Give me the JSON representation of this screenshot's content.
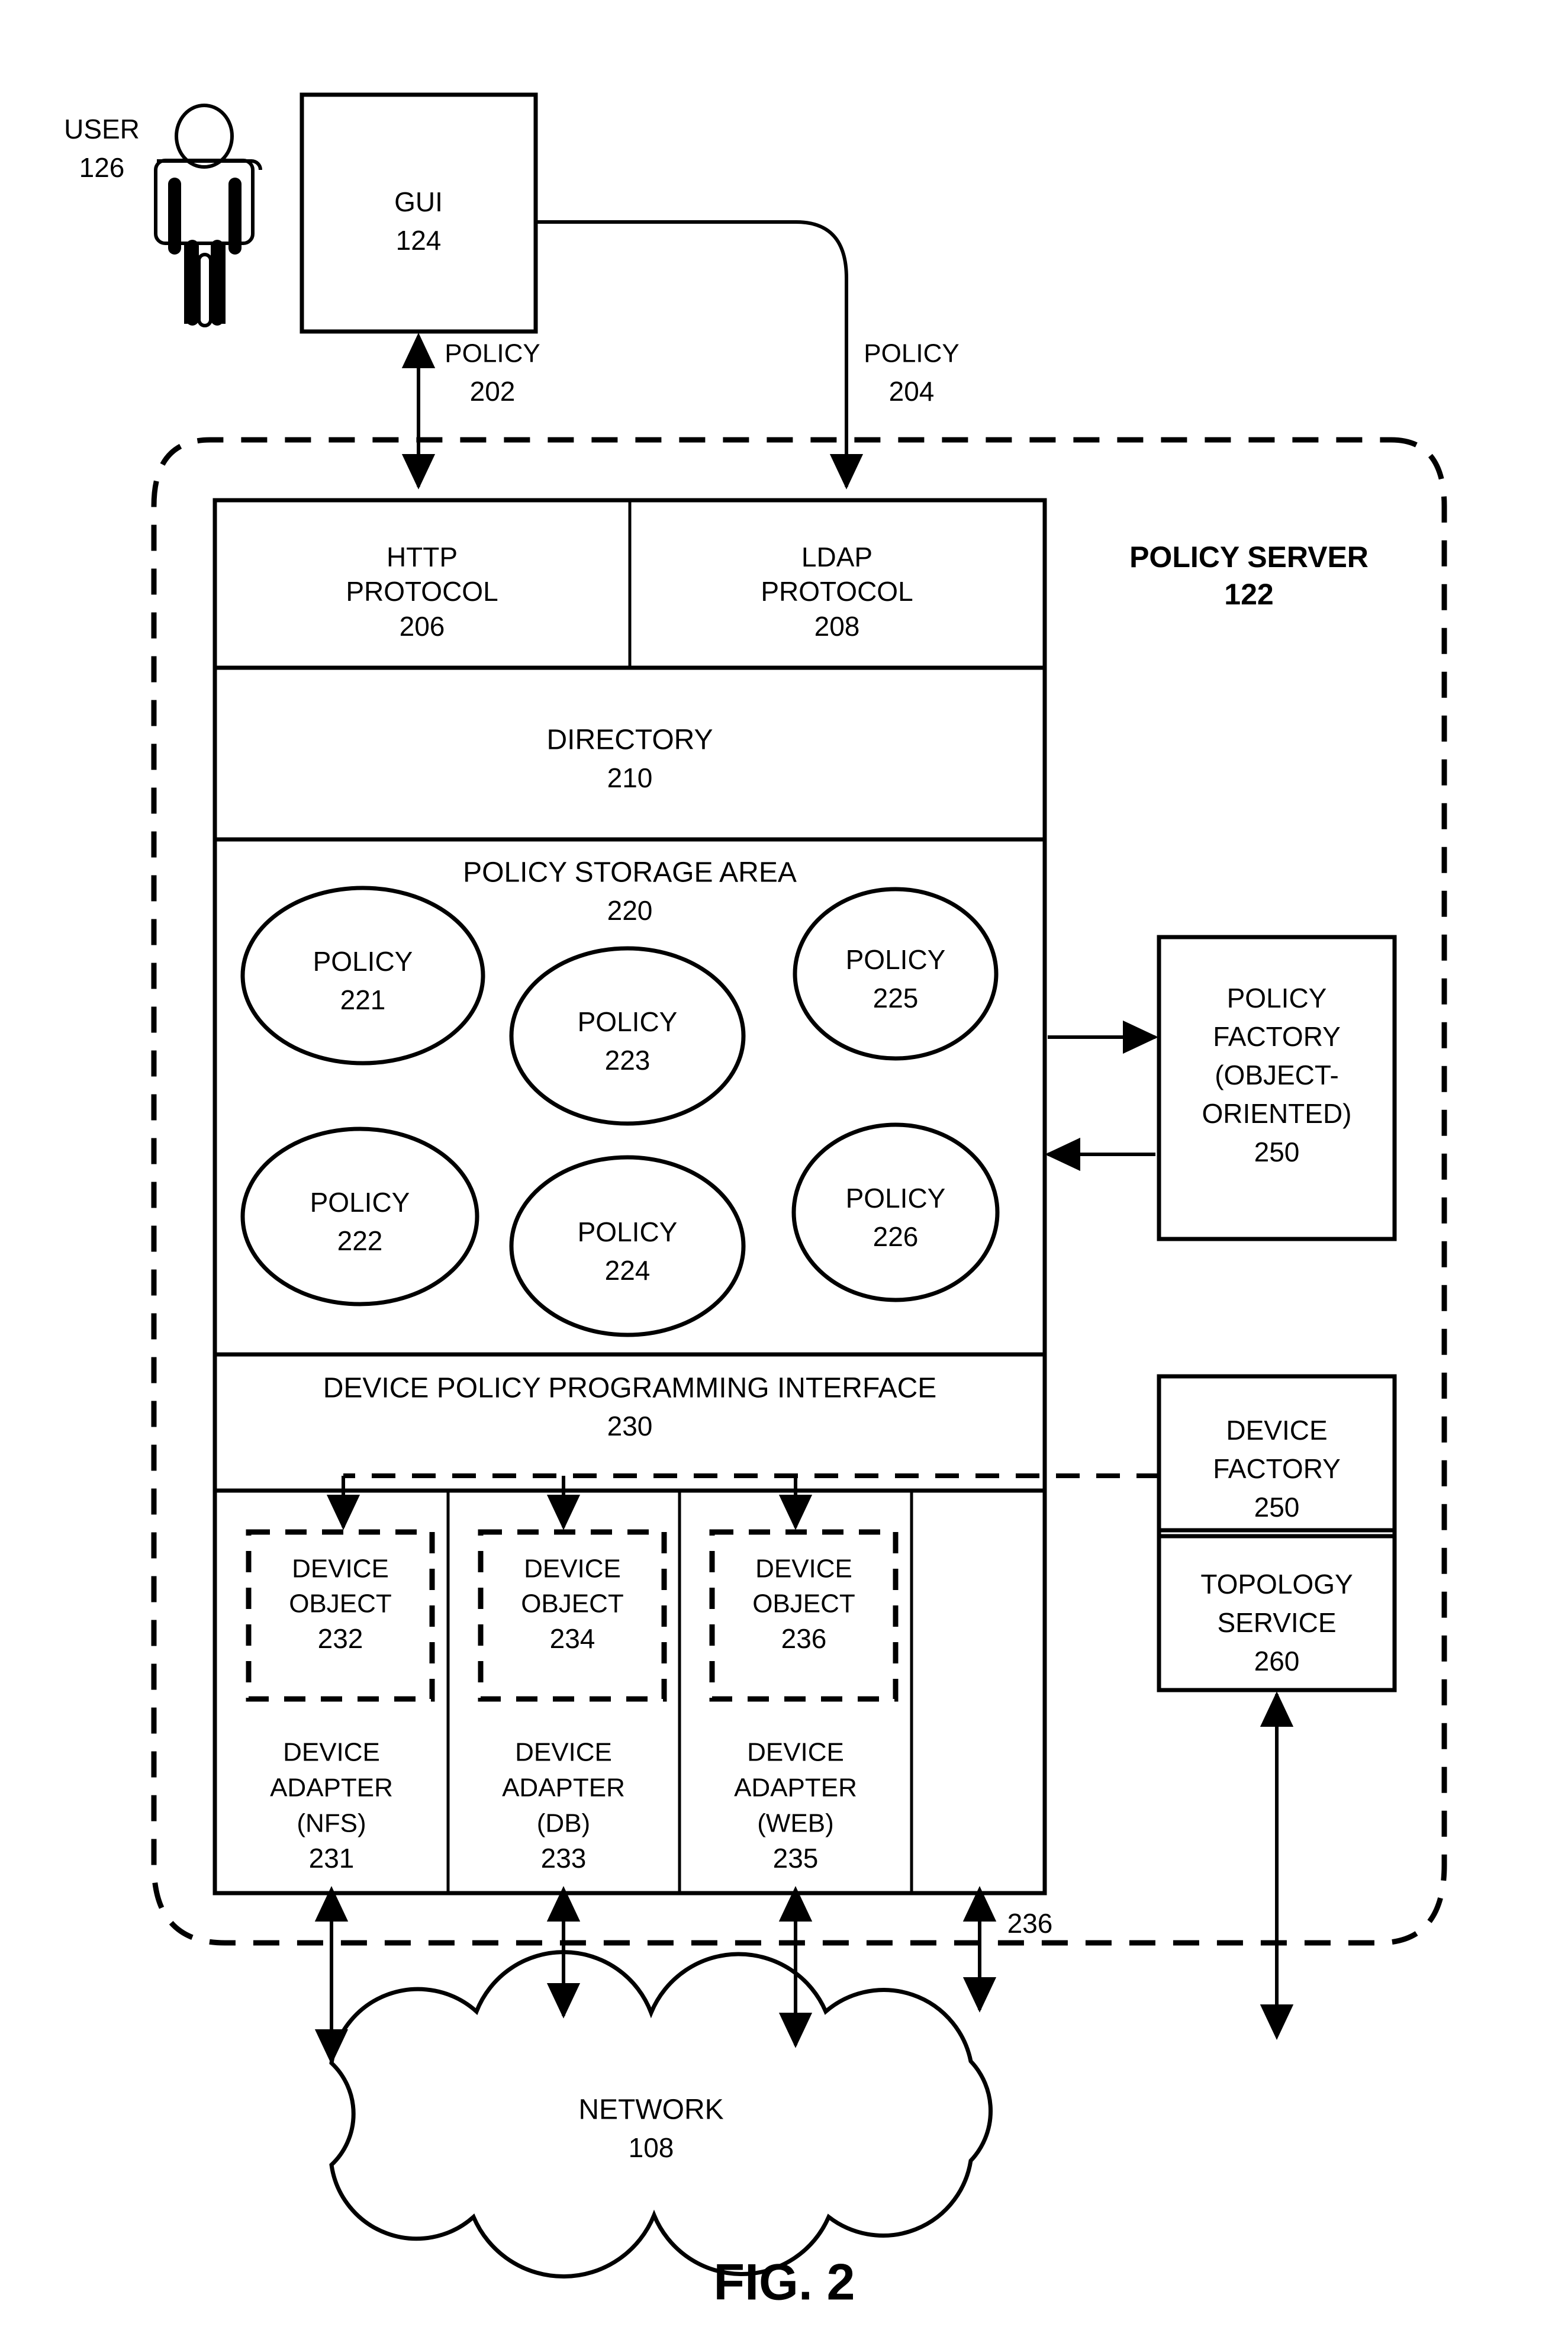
{
  "figure": {
    "caption": "FIG. 2"
  },
  "actor": {
    "label": "USER",
    "ref": "126",
    "icon": "person-icon"
  },
  "gui": {
    "label": "GUI",
    "ref": "124"
  },
  "flows": [
    {
      "label": "POLICY",
      "ref": "202",
      "name": "policy-flow-202"
    },
    {
      "label": "POLICY",
      "ref": "204",
      "name": "policy-flow-204"
    }
  ],
  "policy_server": {
    "label": "POLICY SERVER",
    "ref": "122"
  },
  "protocols": [
    {
      "line1": "HTTP",
      "line2": "PROTOCOL",
      "ref": "206",
      "name": "http-protocol-block"
    },
    {
      "line1": "LDAP",
      "line2": "PROTOCOL",
      "ref": "208",
      "name": "ldap-protocol-block"
    }
  ],
  "directory": {
    "label": "DIRECTORY",
    "ref": "210"
  },
  "policy_storage": {
    "label": "POLICY STORAGE AREA",
    "ref": "220",
    "policies": [
      {
        "label": "POLICY",
        "ref": "221"
      },
      {
        "label": "POLICY",
        "ref": "222"
      },
      {
        "label": "POLICY",
        "ref": "223"
      },
      {
        "label": "POLICY",
        "ref": "224"
      },
      {
        "label": "POLICY",
        "ref": "225"
      },
      {
        "label": "POLICY",
        "ref": "226"
      }
    ]
  },
  "dppi": {
    "label": "DEVICE POLICY PROGRAMMING INTERFACE",
    "ref": "230"
  },
  "device_columns": [
    {
      "object_line1": "DEVICE",
      "object_line2": "OBJECT",
      "object_ref": "232",
      "adapter_line1": "DEVICE",
      "adapter_line2": "ADAPTER",
      "adapter_kind": "(NFS)",
      "adapter_ref": "231"
    },
    {
      "object_line1": "DEVICE",
      "object_line2": "OBJECT",
      "object_ref": "234",
      "adapter_line1": "DEVICE",
      "adapter_line2": "ADAPTER",
      "adapter_kind": "(DB)",
      "adapter_ref": "233"
    },
    {
      "object_line1": "DEVICE",
      "object_line2": "OBJECT",
      "object_ref": "236",
      "adapter_line1": "DEVICE",
      "adapter_line2": "ADAPTER",
      "adapter_kind": "(WEB)",
      "adapter_ref": "235"
    }
  ],
  "side_services": [
    {
      "name": "policy-factory-box",
      "lines": [
        "POLICY",
        "FACTORY",
        "(OBJECT-",
        "ORIENTED)"
      ],
      "ref": "250"
    },
    {
      "name": "device-factory-box",
      "lines": [
        "DEVICE",
        "FACTORY"
      ],
      "ref": "250"
    },
    {
      "name": "topology-service-box",
      "lines": [
        "TOPOLOGY",
        "SERVICE"
      ],
      "ref": "260"
    }
  ],
  "network": {
    "label": "NETWORK",
    "ref": "108"
  },
  "bus": {
    "ref": "236"
  },
  "colors": {
    "stroke": "#000000",
    "background": "#ffffff"
  }
}
